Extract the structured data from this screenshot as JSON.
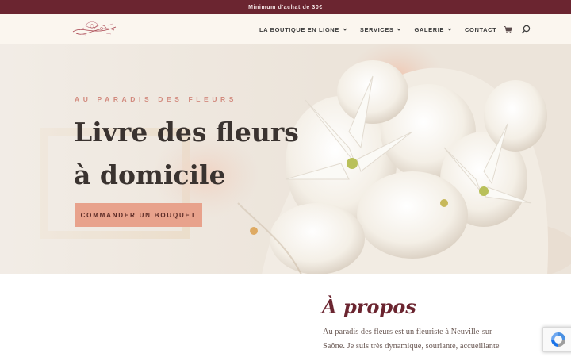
{
  "topbar": {
    "text": "Minimum d'achat de 30€"
  },
  "header": {
    "logo_icon": "floral-wreath-logo",
    "nav": [
      {
        "label": "LA BOUTIQUE EN LIGNE",
        "dropdown": true
      },
      {
        "label": "SERVICES",
        "dropdown": true
      },
      {
        "label": "GALERIE",
        "dropdown": true
      },
      {
        "label": "CONTACT",
        "dropdown": false
      }
    ],
    "cart_icon": "shopping-cart-icon",
    "search_icon": "search-icon"
  },
  "hero": {
    "kicker": "AU PARADIS DES FLEURS",
    "title": "Livre des fleurs à domicile",
    "button": "COMMANDER UN BOUQUET",
    "image": "white-flower-bouquet"
  },
  "about": {
    "title": "À propos",
    "text": "Au paradis des fleurs est un fleuriste à Neuville-sur-Saône. Je suis très dynamique, souriante, accueillante et à"
  },
  "colors": {
    "topbar": "#6b2530",
    "accent": "#e8a28c",
    "kicker": "#d28a7e",
    "heading": "#6b2530"
  }
}
